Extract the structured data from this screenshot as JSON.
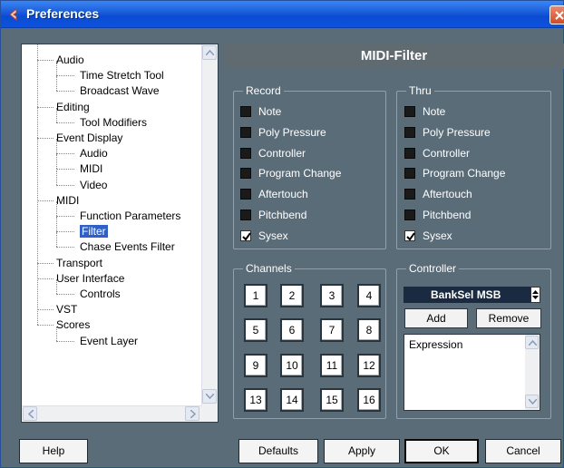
{
  "window": {
    "title": "Preferences"
  },
  "tree": {
    "items": [
      {
        "label": "Audio"
      },
      {
        "label": "Time Stretch Tool"
      },
      {
        "label": "Broadcast Wave"
      },
      {
        "label": "Editing"
      },
      {
        "label": "Tool Modifiers"
      },
      {
        "label": "Event Display"
      },
      {
        "label": "Audio"
      },
      {
        "label": "MIDI"
      },
      {
        "label": "Video"
      },
      {
        "label": "MIDI"
      },
      {
        "label": "Function Parameters"
      },
      {
        "label": "Filter"
      },
      {
        "label": "Chase Events Filter"
      },
      {
        "label": "Transport"
      },
      {
        "label": "User Interface"
      },
      {
        "label": "Controls"
      },
      {
        "label": "VST"
      },
      {
        "label": "Scores"
      },
      {
        "label": "Event Layer"
      }
    ],
    "selected": "Filter"
  },
  "panel": {
    "title": "MIDI-Filter"
  },
  "record": {
    "title": "Record",
    "items": [
      {
        "label": "Note",
        "checked": false
      },
      {
        "label": "Poly Pressure",
        "checked": false
      },
      {
        "label": "Controller",
        "checked": false
      },
      {
        "label": "Program Change",
        "checked": false
      },
      {
        "label": "Aftertouch",
        "checked": false
      },
      {
        "label": "Pitchbend",
        "checked": false
      },
      {
        "label": "Sysex",
        "checked": true
      }
    ]
  },
  "thru": {
    "title": "Thru",
    "items": [
      {
        "label": "Note",
        "checked": false
      },
      {
        "label": "Poly Pressure",
        "checked": false
      },
      {
        "label": "Controller",
        "checked": false
      },
      {
        "label": "Program Change",
        "checked": false
      },
      {
        "label": "Aftertouch",
        "checked": false
      },
      {
        "label": "Pitchbend",
        "checked": false
      },
      {
        "label": "Sysex",
        "checked": true
      }
    ]
  },
  "channels": {
    "title": "Channels",
    "buttons": [
      "1",
      "2",
      "3",
      "4",
      "5",
      "6",
      "7",
      "8",
      "9",
      "10",
      "11",
      "12",
      "13",
      "14",
      "15",
      "16"
    ]
  },
  "controller": {
    "title": "Controller",
    "selected": "BankSel MSB",
    "add_label": "Add",
    "remove_label": "Remove",
    "list": [
      "Expression"
    ]
  },
  "footer": {
    "help": "Help",
    "defaults": "Defaults",
    "apply": "Apply",
    "ok": "OK",
    "cancel": "Cancel"
  },
  "colors": {
    "dialog_bg": "#5b6c79",
    "titlebar": "#0b4bd1",
    "selection": "#2f5fc7",
    "controller_select_bg": "#1a2a40"
  }
}
